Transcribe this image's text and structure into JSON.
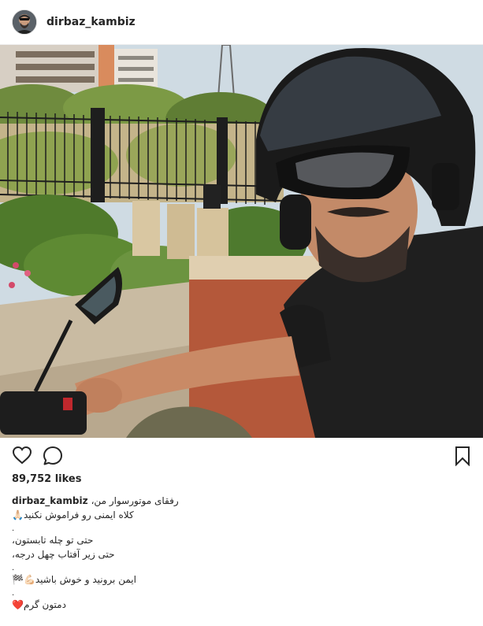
{
  "header": {
    "username": "dirbaz_kambiz",
    "avatar_icon": "profile-photo"
  },
  "actions": {
    "like_icon": "heart-outline-icon",
    "comment_icon": "comment-bubble-icon",
    "save_icon": "bookmark-icon"
  },
  "likes": {
    "text": "89,752 likes"
  },
  "caption": {
    "username": "dirbaz_kambiz",
    "lines": [
      "رفقای موتورسوار من،",
      "کلاه ایمنی رو فراموش نکنید🙏🏻",
      ".",
      "حتی تو چله تابستون،",
      "حتی زیر آفتاب چهل درجه،",
      ".",
      "ایمن برونید و خوش باشید💪🏻🏁",
      ".",
      "دمتون گرم❤️"
    ]
  },
  "colors": {
    "text": "#262626",
    "border": "#efefef",
    "background": "#ffffff"
  }
}
